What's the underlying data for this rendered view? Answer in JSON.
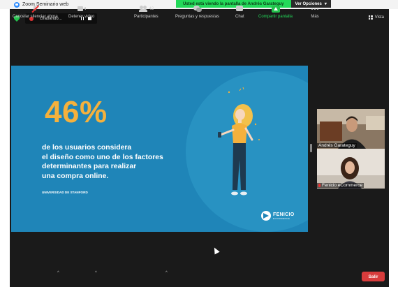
{
  "window": {
    "title": "Zoom Seminario web"
  },
  "share_banner": {
    "message": "Usted está viendo la pantalla de Andrés Garateguy",
    "options_label": "Ver Opciones",
    "options_caret": "▾"
  },
  "recording": {
    "label": "Grabando..."
  },
  "view": {
    "label": "Vista"
  },
  "slide": {
    "percent": "46%",
    "lines": [
      "de los usuarios considera",
      "el diseño como uno de los factores",
      "determinantes para realizar",
      "una compra online."
    ],
    "source": "UNIVERSIDAD DE STANFORD",
    "logo_name": "FENICIO",
    "logo_sub": "ECOMMERCE",
    "background": "#1f85b8",
    "accent": "#f5b13c"
  },
  "participants": [
    {
      "name": "Andrés Garateguy"
    },
    {
      "name": "Fenicio eCommerce"
    }
  ],
  "toolbar": {
    "mute": "Cancelar silenciar ahora",
    "video": "Detener video",
    "participants": "Participantes",
    "participants_count": "42",
    "qa": "Preguntas y respuestas",
    "chat": "Chat",
    "share": "Compartir pantalla",
    "more": "Más",
    "leave": "Salir",
    "caret": "^"
  }
}
